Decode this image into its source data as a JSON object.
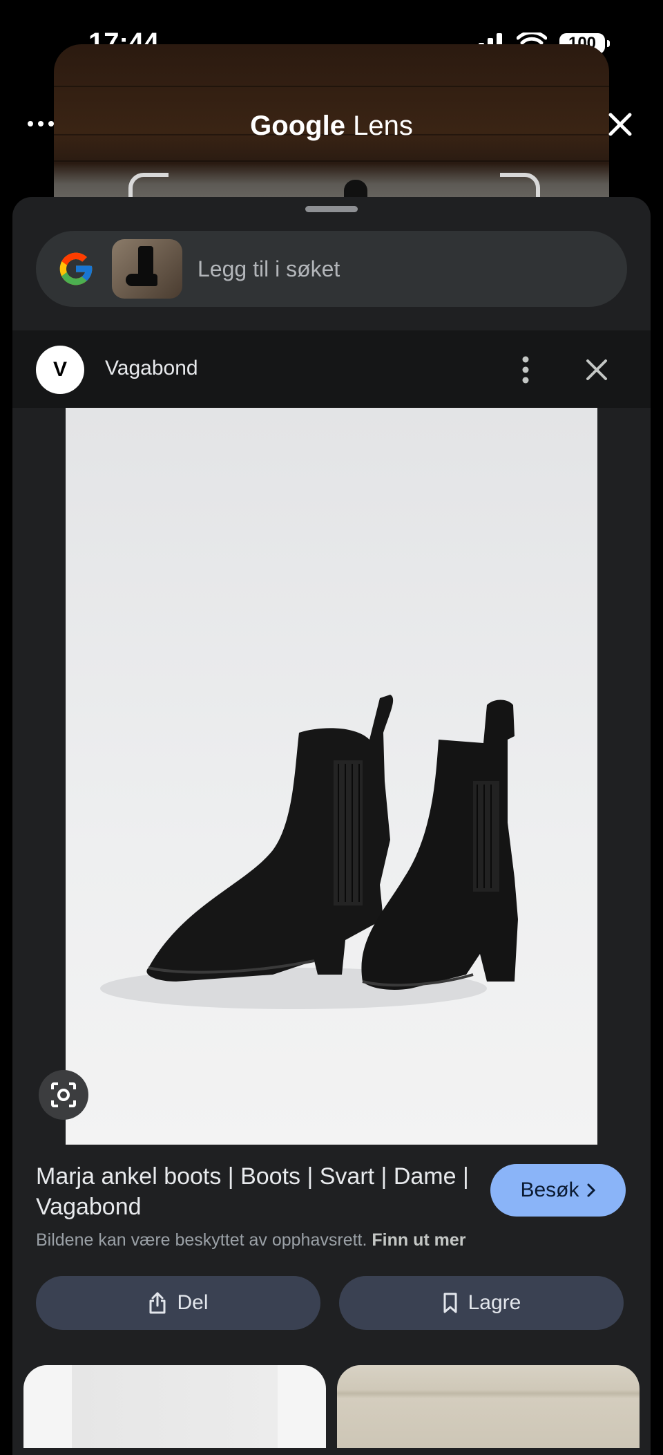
{
  "status_bar": {
    "time": "17:44",
    "battery": "100"
  },
  "header": {
    "brand": "Google",
    "product": "Lens"
  },
  "search": {
    "placeholder": "Legg til i søket"
  },
  "source": {
    "initial": "V",
    "name": "Vagabond"
  },
  "result": {
    "title": "Marja ankel boots | Boots | Svart | Dame | Vagabond",
    "visit_label": "Besøk",
    "copyright_text": "Bildene kan være beskyttet av opphavsrett.",
    "learn_more": "Finn ut mer",
    "share_label": "Del",
    "save_label": "Lagre"
  },
  "colors": {
    "accent": "#8ab4f8",
    "sheet": "#1f2022",
    "action_button": "#3a4152"
  },
  "icons": [
    "more-icon",
    "close-icon",
    "google-g-icon",
    "kebab-icon",
    "visual-search-icon",
    "share-icon",
    "bookmark-icon",
    "chevron-right-icon"
  ]
}
